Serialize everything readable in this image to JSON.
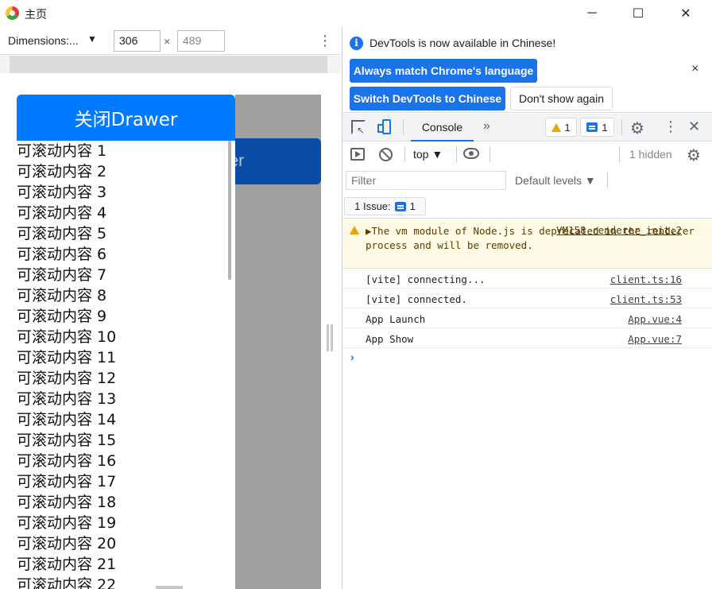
{
  "window": {
    "title": "主页",
    "minimize_glyph": "─",
    "maximize_glyph": "☐",
    "close_glyph": "✕"
  },
  "device_toolbar": {
    "dimensions_label": "Dimensions:...",
    "dropdown_glyph": "▼",
    "width": "306",
    "height": "489",
    "times_glyph": "×",
    "more_glyph": "⋮"
  },
  "app": {
    "close_drawer_label": "关闭Drawer",
    "behind_button_text": "ver",
    "list_items": [
      "可滚动内容 1",
      "可滚动内容 2",
      "可滚动内容 3",
      "可滚动内容 4",
      "可滚动内容 5",
      "可滚动内容 6",
      "可滚动内容 7",
      "可滚动内容 8",
      "可滚动内容 9",
      "可滚动内容 10",
      "可滚动内容 11",
      "可滚动内容 12",
      "可滚动内容 13",
      "可滚动内容 14",
      "可滚动内容 15",
      "可滚动内容 16",
      "可滚动内容 17",
      "可滚动内容 18",
      "可滚动内容 19",
      "可滚动内容 20",
      "可滚动内容 21",
      "可滚动内容 22"
    ]
  },
  "devtools": {
    "infobar": {
      "message": "DevTools is now available in Chinese!",
      "always_match": "Always match Chrome's language",
      "switch_chinese": "Switch DevTools to Chinese",
      "dont_show": "Don't show again",
      "info_glyph": "i",
      "close_glyph": "×"
    },
    "tabs": {
      "console": "Console",
      "more_glyph": "»",
      "warnings_count": "1",
      "messages_count": "1",
      "settings_glyph": "⚙",
      "kebab_glyph": "⋮",
      "close_glyph": "✕"
    },
    "console_toolbar": {
      "context": "top ▼",
      "hidden": "1 hidden",
      "settings_glyph": "⚙"
    },
    "filter": {
      "placeholder": "Filter",
      "levels": "Default levels ▼"
    },
    "issues": {
      "label": "1 Issue:",
      "count": "1"
    },
    "messages": [
      {
        "type": "warn",
        "text": "▶The vm module of Node.js is deprecated in the renderer process and will be removed.",
        "source": "VM158 renderer_init:2"
      },
      {
        "type": "log",
        "text": "[vite] connecting...",
        "source": "client.ts:16"
      },
      {
        "type": "log",
        "text": "[vite] connected.",
        "source": "client.ts:53"
      },
      {
        "type": "log",
        "text": "App Launch",
        "source": "App.vue:4"
      },
      {
        "type": "log",
        "text": "App Show",
        "source": "App.vue:7"
      }
    ],
    "prompt_glyph": "›"
  },
  "colors": {
    "accent": "#1a73e8",
    "drawer_button": "#007aff",
    "overlay": "#a0a0a0",
    "warning_bg": "#fffbe6"
  }
}
